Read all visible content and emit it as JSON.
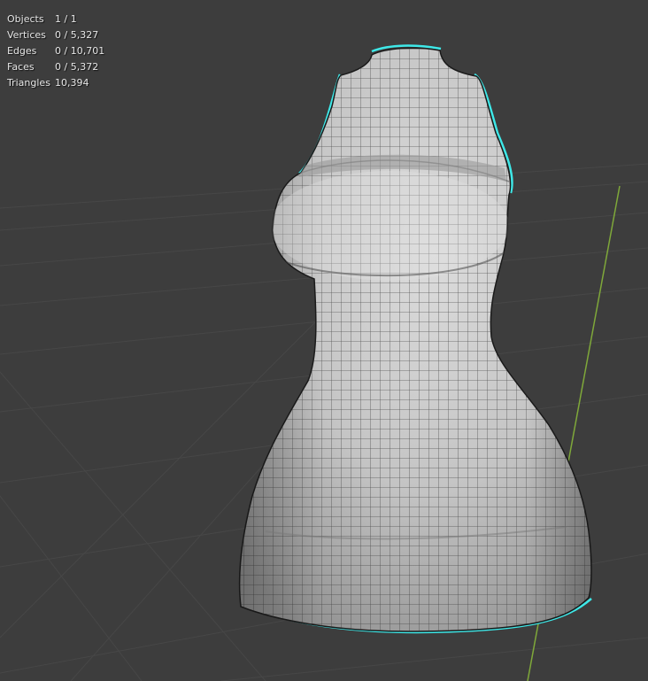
{
  "viewport": {
    "background_color": "#3d3d3d",
    "grid_color": "#4a4a4a",
    "y_axis_color": "#7fa83a",
    "selection_outline_color": "#3ee8e8",
    "mesh_fill_color": "#c9c9c9",
    "wire_color": "#2a2a2a"
  },
  "statistics": [
    {
      "label": "Objects",
      "value": "1 / 1"
    },
    {
      "label": "Vertices",
      "value": "0 / 5,327"
    },
    {
      "label": "Edges",
      "value": "0 / 10,701"
    },
    {
      "label": "Faces",
      "value": "0 / 5,372"
    },
    {
      "label": "Triangles",
      "value": "10,394"
    }
  ],
  "mesh": {
    "icon": "dress-mesh",
    "selected": true
  }
}
